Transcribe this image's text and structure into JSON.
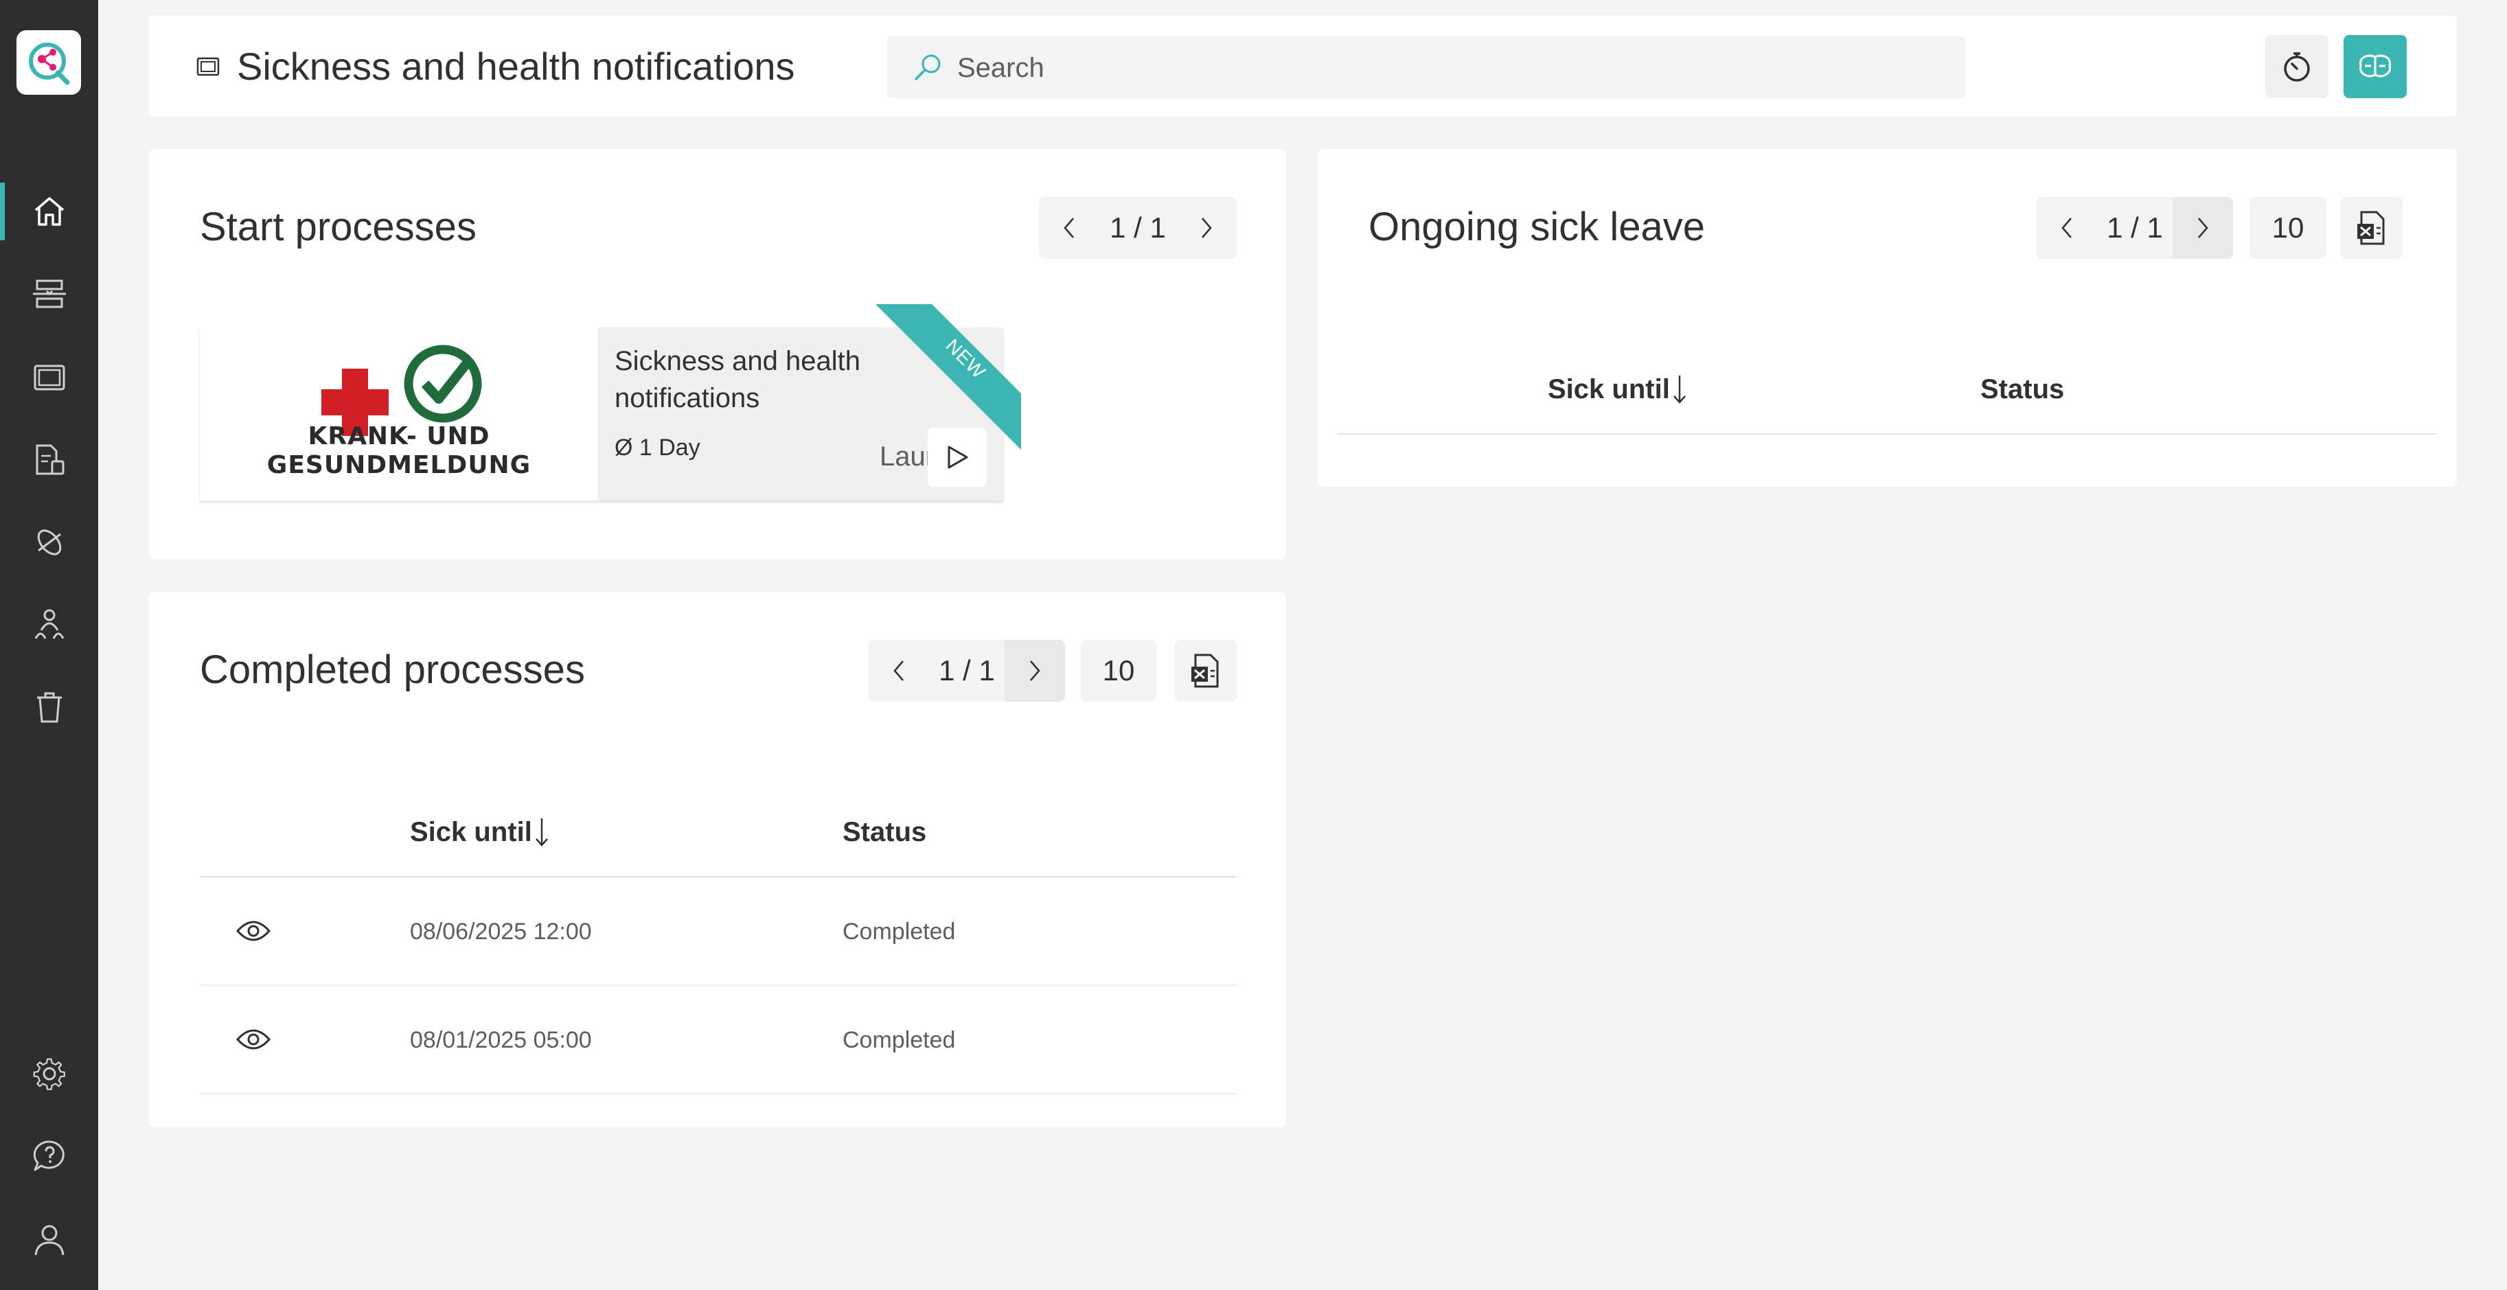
{
  "header": {
    "title": "Sickness and health notifications",
    "search_placeholder": "Search"
  },
  "sidebar": {
    "items": [
      {
        "name": "home",
        "icon": "home-icon"
      },
      {
        "name": "processes",
        "icon": "processes-icon"
      },
      {
        "name": "windows",
        "icon": "window-icon"
      },
      {
        "name": "documents",
        "icon": "documents-icon"
      },
      {
        "name": "tags",
        "icon": "tag-icon"
      },
      {
        "name": "organization",
        "icon": "org-icon"
      },
      {
        "name": "trash",
        "icon": "trash-icon"
      },
      {
        "name": "settings",
        "icon": "gear-icon"
      },
      {
        "name": "help",
        "icon": "help-chat-icon"
      },
      {
        "name": "profile",
        "icon": "user-icon"
      }
    ]
  },
  "start_processes": {
    "title": "Start processes",
    "pager": "1 / 1",
    "tile": {
      "image_lines": [
        "KRANK- UND",
        "GESUNDMELDUNG"
      ],
      "name": "Sickness and health notifications",
      "duration": "Ø 1 Day",
      "launch": "Launch",
      "badge": "NEW"
    }
  },
  "completed": {
    "title": "Completed processes",
    "pager": "1 / 1",
    "count": "10",
    "columns": [
      "Sick until",
      "Status"
    ],
    "rows": [
      {
        "date": "08/06/2025 12:00",
        "status": "Completed"
      },
      {
        "date": "08/01/2025 05:00",
        "status": "Completed"
      }
    ]
  },
  "ongoing": {
    "title": "Ongoing sick leave",
    "pager": "1 / 1",
    "count": "10",
    "columns": [
      "Sick until",
      "Status"
    ]
  },
  "colors": {
    "accent": "#3cb6b3",
    "sidebar": "#2d2d2d",
    "background": "#f3f3f3",
    "cross": "#d32027"
  }
}
